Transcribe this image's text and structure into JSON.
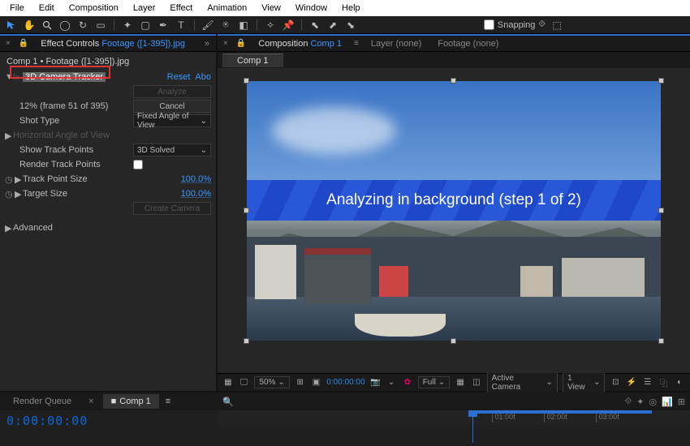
{
  "menubar": [
    "File",
    "Edit",
    "Composition",
    "Layer",
    "Effect",
    "Animation",
    "View",
    "Window",
    "Help"
  ],
  "toolbar": {
    "snapping_label": "Snapping"
  },
  "left_panel": {
    "tab_prefix": "Effect Controls",
    "tab_link": "Footage ([1-395]).jpg",
    "breadcrumb": "Comp 1 • Footage ([1-395]).jpg",
    "effect_name": "3D Camera Tracker",
    "reset": "Reset",
    "about": "Abo",
    "rows": {
      "analyze_btn": "Analyze",
      "progress": "12% (frame 51 of 395)",
      "cancel_btn": "Cancel",
      "shot_type_lbl": "Shot Type",
      "shot_type_val": "Fixed Angle of View",
      "hangle_lbl": "Horizontal Angle of View",
      "show_tp_lbl": "Show Track Points",
      "show_tp_val": "3D Solved",
      "render_tp_lbl": "Render Track Points",
      "tp_size_lbl": "Track Point Size",
      "tp_size_val": "100.0%",
      "target_size_lbl": "Target Size",
      "target_size_val": "100.0%",
      "create_cam_btn": "Create Camera",
      "advanced_lbl": "Advanced"
    }
  },
  "comp_panel": {
    "tab_prefix": "Composition",
    "tab_link": "Comp 1",
    "layer_tab": "Layer (none)",
    "footage_tab": "Footage (none)",
    "sub_tab": "Comp 1",
    "banner_text": "Analyzing in background (step 1 of 2)"
  },
  "viewer_foot": {
    "zoom": "50%",
    "timecode": "0:00:00:00",
    "res": "Full",
    "camera": "Active Camera",
    "views": "1 View"
  },
  "bottom": {
    "render_queue": "Render Queue",
    "comp_tab": "Comp 1",
    "timecode": "0:00:00:00",
    "ticks": [
      {
        "pos": 58,
        "label": "01:00f"
      },
      {
        "pos": 69,
        "label": "02:00f"
      },
      {
        "pos": 80,
        "label": "03:00f"
      }
    ],
    "region_start": 54,
    "region_end": 92,
    "playhead": 54
  }
}
